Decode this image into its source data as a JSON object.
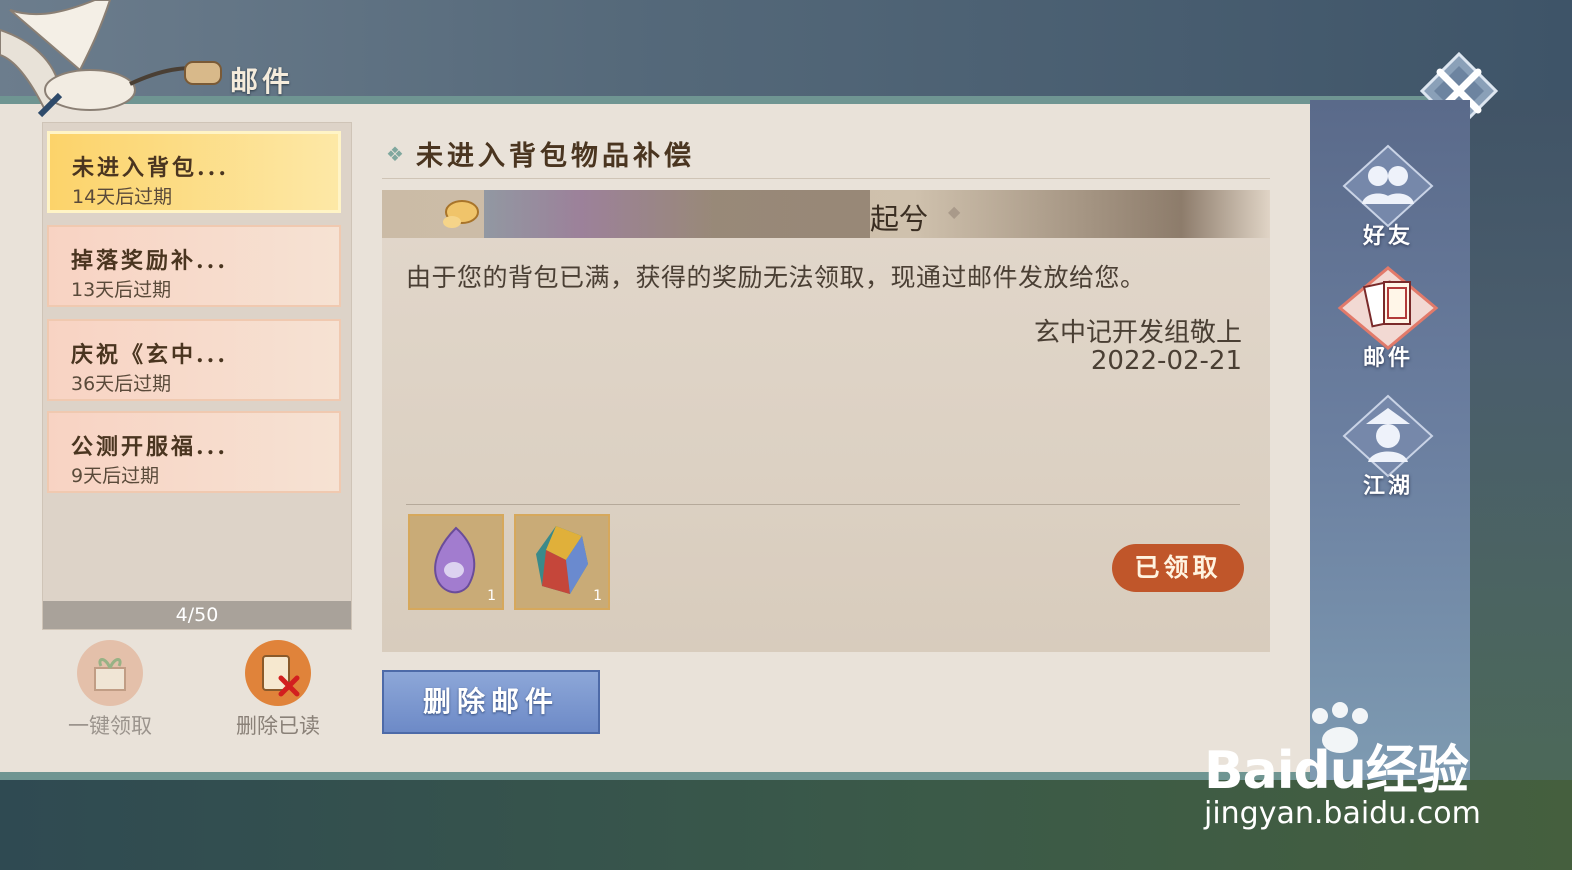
{
  "window": {
    "title": "邮件"
  },
  "mail_list": {
    "items": [
      {
        "title": "未进入背包...",
        "expiry": "14天后过期"
      },
      {
        "title": "掉落奖励补...",
        "expiry": "13天后过期"
      },
      {
        "title": "庆祝《玄中...",
        "expiry": "36天后过期"
      },
      {
        "title": "公测开服福...",
        "expiry": "9天后过期"
      }
    ],
    "counter": "4/50"
  },
  "actions": {
    "claim_all_label": "一键领取",
    "delete_read_label": "删除已读"
  },
  "detail": {
    "title": "未进入背包物品补偿",
    "sender": "起兮",
    "body": "由于您的背包已满，获得的奖励无法领取，现通过邮件发放给您。",
    "signature": "玄中记开发组敬上",
    "date": "2022-02-21",
    "attachments": [
      {
        "icon": "purple-crystal-icon",
        "qty": "1"
      },
      {
        "icon": "rainbow-crystal-icon",
        "qty": "1"
      }
    ],
    "claimed_label": "已领取",
    "delete_label": "删除邮件"
  },
  "nav": {
    "items": [
      {
        "label": "好友",
        "icon": "friends-icon"
      },
      {
        "label": "邮件",
        "icon": "mail-icon"
      },
      {
        "label": "江湖",
        "icon": "jianghu-icon"
      }
    ]
  },
  "watermark": {
    "brand": "Baidu经验",
    "url": "jingyan.baidu.com"
  },
  "colors": {
    "active_item": "#fcd36a",
    "claimed_stamp": "#c0562a",
    "delete_button": "#7d97d0",
    "panel_border": "#6f9592"
  }
}
